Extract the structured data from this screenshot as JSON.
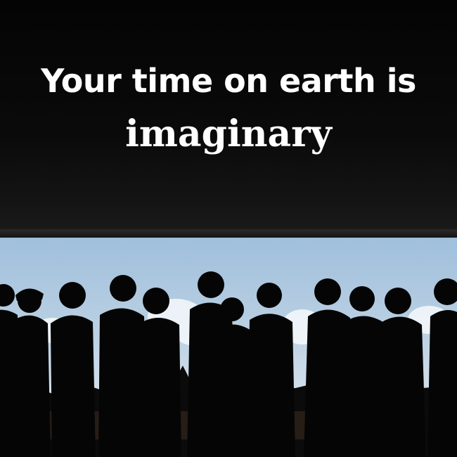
{
  "headline": {
    "line1": "Your time on earth is",
    "line2": "imaginary"
  },
  "colors": {
    "text": "#ffffff",
    "ceiling": "#080808",
    "sky_top": "#9fbfdc",
    "sky_bottom": "#e8eef3",
    "silhouette": "#050505"
  }
}
